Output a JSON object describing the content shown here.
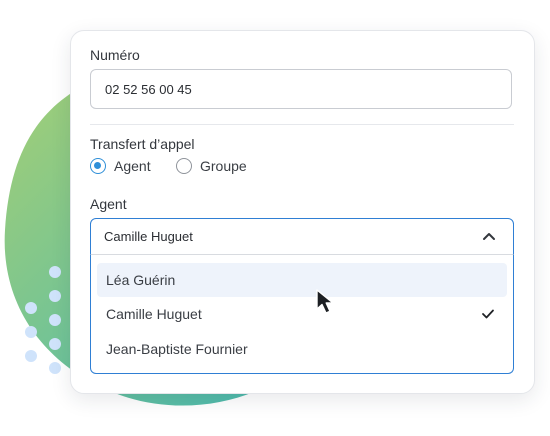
{
  "form": {
    "numero_label": "Numéro",
    "numero_value": "02 52 56 00 45",
    "transfer_label": "Transfert d’appel",
    "radio_options": [
      {
        "label": "Agent",
        "checked": true
      },
      {
        "label": "Groupe",
        "checked": false
      }
    ],
    "agent_label": "Agent",
    "agent_selected": "Camille Huguet",
    "agent_options": [
      {
        "label": "Léa Guérin",
        "hovered": true,
        "selected": false
      },
      {
        "label": "Camille Huguet",
        "hovered": false,
        "selected": true
      },
      {
        "label": "Jean-Baptiste Fournier",
        "hovered": false,
        "selected": false
      }
    ]
  },
  "icons": {
    "chevron": "chevron-up-icon",
    "check": "check-icon",
    "cursor": "mouse-pointer-icon"
  },
  "colors": {
    "accent": "#2f7fd4",
    "radio_checked": "#2f8fd8",
    "blob_start": "#a6cf74",
    "blob_end": "#3fb6b5",
    "dots": "#cfe3fb",
    "hover_bg": "#eef3fb"
  }
}
